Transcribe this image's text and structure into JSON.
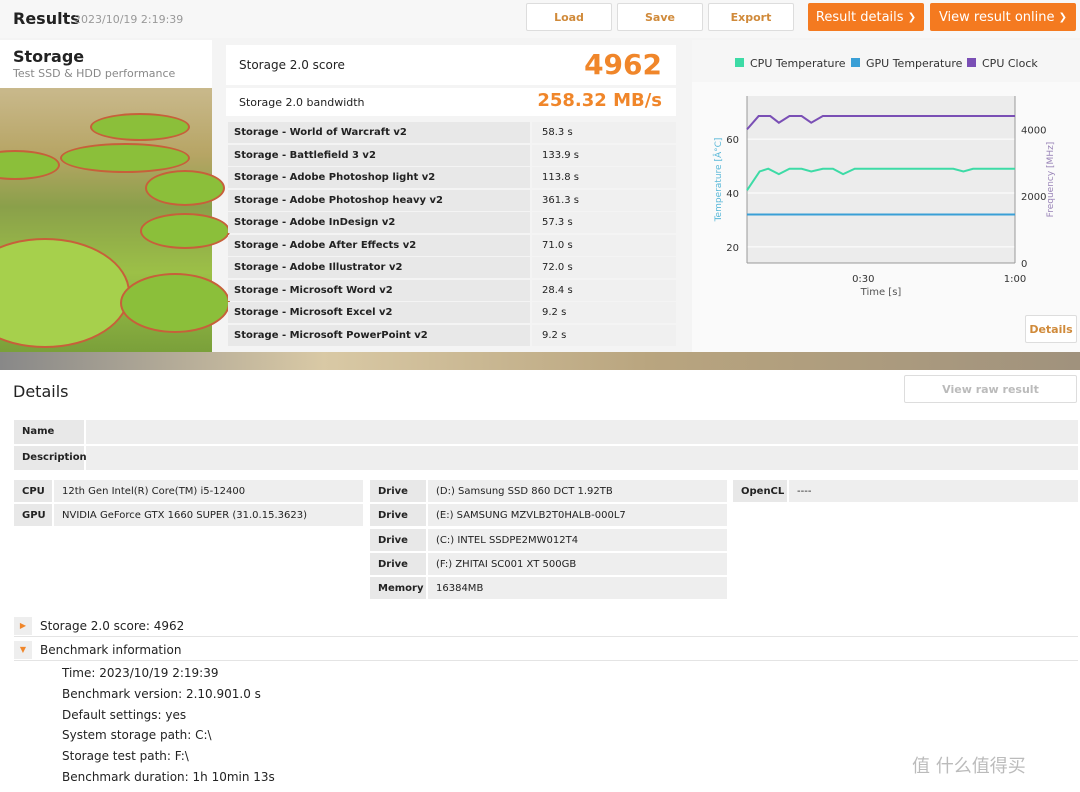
{
  "header": {
    "title": "Results",
    "date": "2023/10/19 2:19:39",
    "load": "Load",
    "save": "Save",
    "export": "Export",
    "result_details": "Result details",
    "view_online": "View result online",
    "chevron": "❯"
  },
  "test": {
    "name": "Storage",
    "subtitle": "Test SSD & HDD performance"
  },
  "score": {
    "label": "Storage 2.0 score",
    "value": "4962",
    "bw_label": "Storage 2.0 bandwidth",
    "bw_value": "258.32 MB/s"
  },
  "subtests": [
    {
      "name": "Storage - World of Warcraft v2",
      "value": "58.3 s"
    },
    {
      "name": "Storage - Battlefield 3 v2",
      "value": "133.9 s"
    },
    {
      "name": "Storage - Adobe Photoshop light v2",
      "value": "113.8 s"
    },
    {
      "name": "Storage - Adobe Photoshop heavy v2",
      "value": "361.3 s"
    },
    {
      "name": "Storage - Adobe InDesign v2",
      "value": "57.3 s"
    },
    {
      "name": "Storage - Adobe After Effects v2",
      "value": "71.0 s"
    },
    {
      "name": "Storage - Adobe Illustrator v2",
      "value": "72.0 s"
    },
    {
      "name": "Storage - Microsoft Word v2",
      "value": "28.4 s"
    },
    {
      "name": "Storage - Microsoft Excel v2",
      "value": "9.2 s"
    },
    {
      "name": "Storage - Microsoft PowerPoint v2",
      "value": "9.2 s"
    }
  ],
  "chart_data": {
    "type": "line",
    "xlabel": "Time [s]",
    "ylabel": "Temperature [Â°C]",
    "y2label": "Frequency [MHz]",
    "xticks": [
      "0:30",
      "1:00"
    ],
    "yticks": [
      "20",
      "40",
      "60"
    ],
    "y2ticks": [
      "0",
      "2000",
      "4000"
    ],
    "xlim": [
      7,
      60
    ],
    "ylim": [
      14,
      76
    ],
    "y2lim": [
      0,
      5000
    ],
    "legend": "top",
    "grid": true,
    "series": [
      {
        "name": "CPU Temperature",
        "color": "#3ddba6",
        "axis": "y",
        "x": [
          7,
          9.5,
          11.2,
          13.3,
          15.4,
          17.8,
          19.7,
          22,
          24,
          26,
          28.3,
          47.8,
          49.8,
          51.7,
          60
        ],
        "y": [
          41,
          48,
          49,
          47,
          49,
          49,
          48,
          49,
          49,
          47,
          49,
          49,
          48,
          49,
          49
        ]
      },
      {
        "name": "GPU Temperature",
        "color": "#3a9fd6",
        "axis": "y",
        "x": [
          7,
          60
        ],
        "y": [
          32,
          32
        ]
      },
      {
        "name": "CPU Clock",
        "color": "#7a4fb5",
        "axis": "y2",
        "x": [
          7,
          9.3,
          11.6,
          13.3,
          15.4,
          17.8,
          19.7,
          22,
          60
        ],
        "y": [
          4000,
          4400,
          4400,
          4200,
          4400,
          4400,
          4200,
          4400,
          4400
        ]
      }
    ]
  },
  "chart_details": "Details",
  "details": {
    "title": "Details",
    "view_raw": "View raw result",
    "name_label": "Name",
    "description_label": "Description",
    "cpu_label": "CPU",
    "cpu": "12th Gen Intel(R) Core(TM) i5-12400",
    "gpu_label": "GPU",
    "gpu": "NVIDIA GeForce GTX 1660 SUPER (31.0.15.3623)",
    "drives": [
      {
        "label": "Drive",
        "value": "(D:) Samsung SSD 860 DCT 1.92TB"
      },
      {
        "label": "Drive",
        "value": "(E:) SAMSUNG MZVLB2T0HALB-000L7"
      },
      {
        "label": "Drive",
        "value": "(C:) INTEL SSDPE2MW012T4"
      },
      {
        "label": "Drive",
        "value": "(F:) ZHITAI SC001 XT 500GB"
      },
      {
        "label": "Memory",
        "value": "16384MB"
      }
    ],
    "opencl_label": "OpenCL",
    "opencl": "----",
    "tree_score": "Storage 2.0 score: 4962",
    "tree_bench": "Benchmark information",
    "bench_info": [
      "Time: 2023/10/19 2:19:39",
      "Benchmark version: 2.10.901.0 s",
      "Default settings: yes",
      "System storage path: C:\\",
      "Storage test path: F:\\",
      "Benchmark duration: 1h 10min 13s"
    ]
  },
  "watermark": "值 什么值得买"
}
